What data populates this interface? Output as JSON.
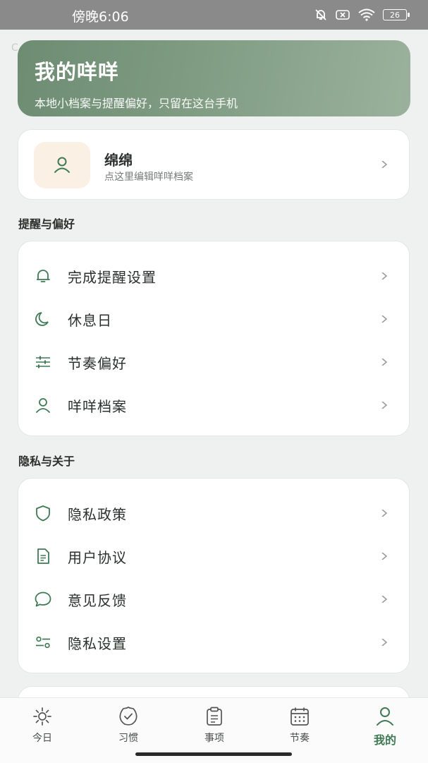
{
  "status": {
    "time": "傍晚6:06",
    "battery": "26"
  },
  "stray_char": "C",
  "header": {
    "title": "我的咩咩",
    "subtitle": "本地小档案与提醒偏好，只留在这台手机"
  },
  "profile": {
    "name": "绵绵",
    "hint": "点这里编辑咩咩档案"
  },
  "sections": {
    "reminders": {
      "title": "提醒与偏好",
      "items": [
        {
          "label": "完成提醒设置",
          "icon": "bell-icon"
        },
        {
          "label": "休息日",
          "icon": "moon-icon"
        },
        {
          "label": "节奏偏好",
          "icon": "sliders-icon"
        },
        {
          "label": "咩咩档案",
          "icon": "user-icon"
        }
      ]
    },
    "privacy": {
      "title": "隐私与关于",
      "items": [
        {
          "label": "隐私政策",
          "icon": "shield-icon"
        },
        {
          "label": "用户协议",
          "icon": "document-icon"
        },
        {
          "label": "意见反馈",
          "icon": "chat-bubble-icon"
        },
        {
          "label": "隐私设置",
          "icon": "toggle-settings-icon"
        }
      ]
    }
  },
  "nav": {
    "tabs": [
      {
        "label": "今日",
        "icon": "sun-icon"
      },
      {
        "label": "习惯",
        "icon": "check-badge-icon"
      },
      {
        "label": "事项",
        "icon": "clipboard-icon"
      },
      {
        "label": "节奏",
        "icon": "calendar-icon"
      },
      {
        "label": "我的",
        "icon": "user-icon"
      }
    ],
    "active": "我的"
  },
  "colors": {
    "accent": "#3f7a55",
    "banner": "#7c9a80",
    "background": "#eef1ef"
  }
}
